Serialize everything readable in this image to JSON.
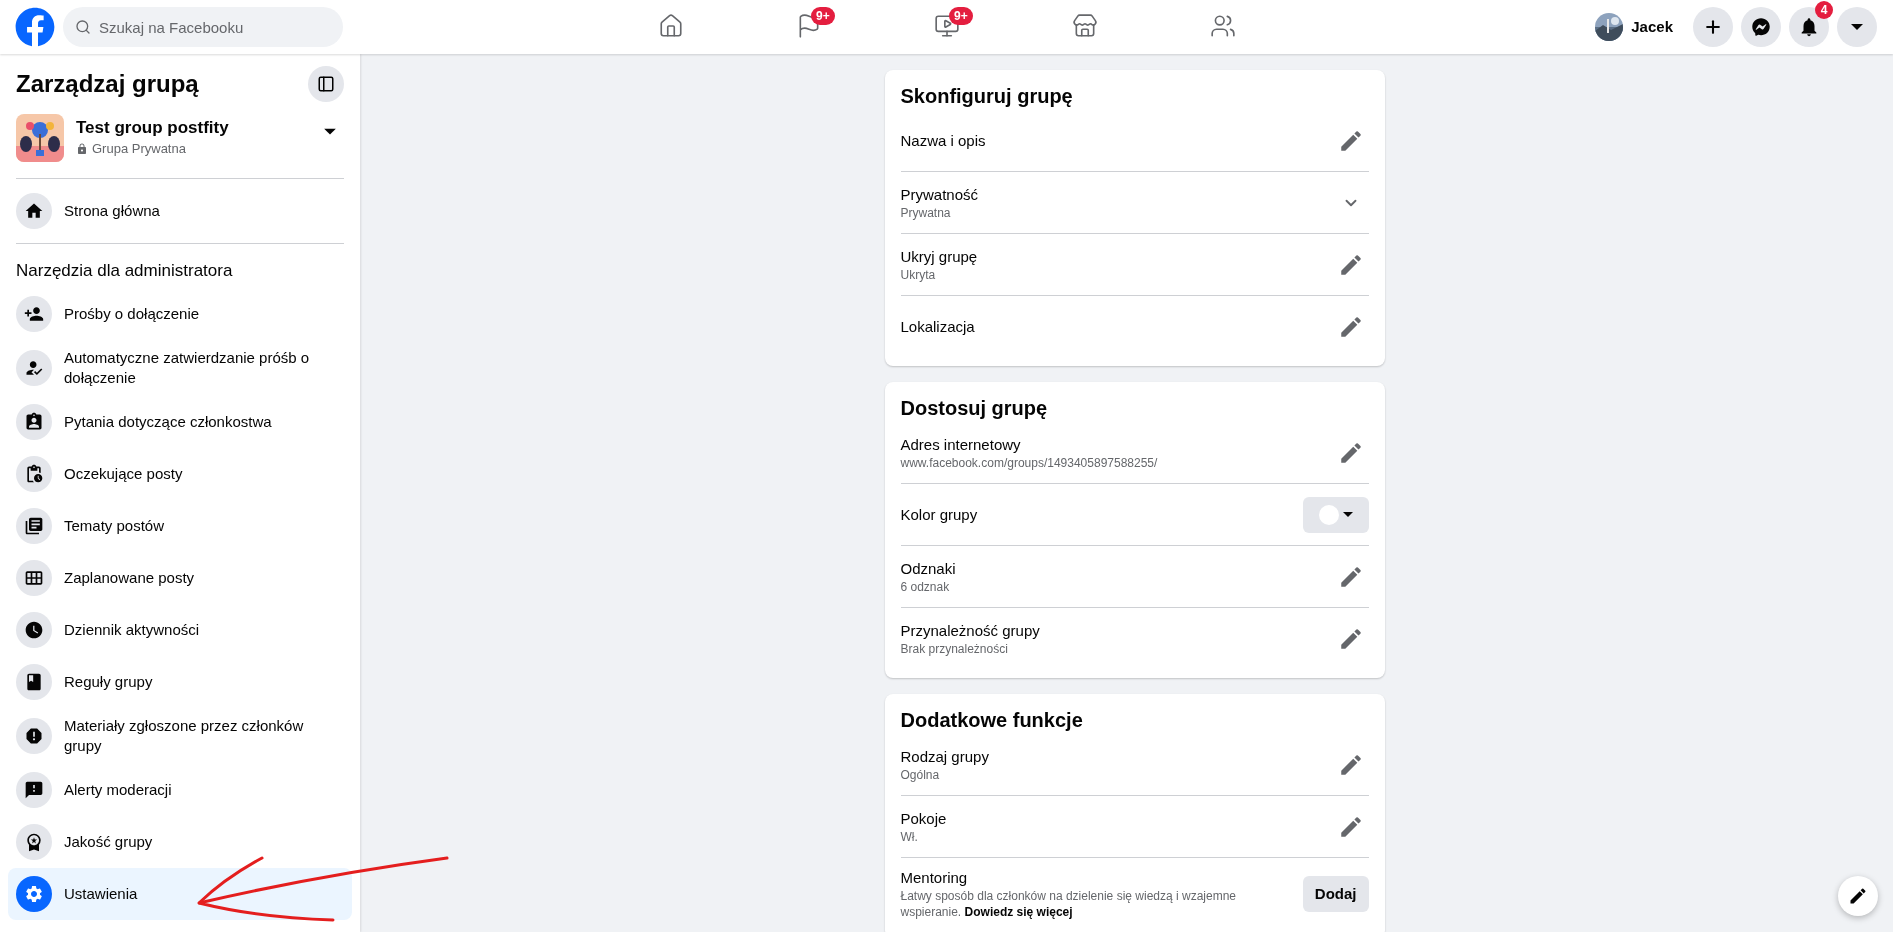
{
  "top_bar": {
    "search": {
      "placeholder": "Szukaj na Facebooku"
    },
    "nav_tabs": [
      {
        "kind": "home",
        "selected": false
      },
      {
        "kind": "flag",
        "selected": false,
        "badge": "9+"
      },
      {
        "kind": "video",
        "selected": false,
        "badge": "9+"
      },
      {
        "kind": "store",
        "selected": false
      },
      {
        "kind": "groups",
        "selected": false
      }
    ],
    "profile": {
      "name": "Jacek"
    },
    "actions": [
      {
        "kind": "plus"
      },
      {
        "kind": "messenger"
      },
      {
        "kind": "bell",
        "badge": "4"
      },
      {
        "kind": "caret"
      }
    ]
  },
  "sidebar": {
    "title": "Zarządzaj grupą",
    "group": {
      "name": "Test group postfity",
      "privacy": "Grupa Prywatna"
    },
    "home_item": {
      "kind": "home",
      "label": "Strona główna",
      "selected": false
    },
    "section_title": "Narzędzia dla administratora",
    "items": [
      {
        "kind": "requests",
        "label": "Prośby o dołączenie",
        "selected": false
      },
      {
        "kind": "auto",
        "label": "Automatyczne zatwierdzanie próśb o dołączenie",
        "selected": false
      },
      {
        "kind": "questions",
        "label": "Pytania dotyczące członkostwa",
        "selected": false
      },
      {
        "kind": "pending",
        "label": "Oczekujące posty",
        "selected": false
      },
      {
        "kind": "topics",
        "label": "Tematy postów",
        "selected": false
      },
      {
        "kind": "scheduled",
        "label": "Zaplanowane posty",
        "selected": false
      },
      {
        "kind": "log",
        "label": "Dziennik aktywności",
        "selected": false
      },
      {
        "kind": "rules",
        "label": "Reguły grupy",
        "selected": false
      },
      {
        "kind": "reported",
        "label": "Materiały zgłoszone przez członków grupy",
        "selected": false
      },
      {
        "kind": "alerts",
        "label": "Alerty moderacji",
        "selected": false
      },
      {
        "kind": "quality",
        "label": "Jakość grupy",
        "selected": false
      },
      {
        "kind": "settings",
        "label": "Ustawienia",
        "selected": true
      }
    ]
  },
  "cards": [
    {
      "title": "Skonfiguruj grupę",
      "rows": [
        {
          "kind": "edit",
          "label": "Nazwa i opis"
        },
        {
          "kind": "expand",
          "label": "Prywatność",
          "value": "Prywatna"
        },
        {
          "kind": "edit",
          "label": "Ukryj grupę",
          "value": "Ukryta"
        },
        {
          "kind": "edit",
          "label": "Lokalizacja"
        }
      ]
    },
    {
      "title": "Dostosuj grupę",
      "rows": [
        {
          "kind": "edit",
          "label": "Adres internetowy",
          "value": "www.facebook.com/groups/1493405897588255/"
        },
        {
          "kind": "color",
          "label": "Kolor grupy"
        },
        {
          "kind": "edit",
          "label": "Odznaki",
          "value": "6 odznak"
        },
        {
          "kind": "edit",
          "label": "Przynależność grupy",
          "value": "Brak przynależności"
        }
      ]
    },
    {
      "title": "Dodatkowe funkcje",
      "rows": [
        {
          "kind": "edit",
          "label": "Rodzaj grupy",
          "value": "Ogólna"
        },
        {
          "kind": "edit",
          "label": "Pokoje",
          "value": "Wł."
        },
        {
          "kind": "button",
          "label": "Mentoring",
          "value": "Łatwy sposób dla członków na dzielenie się wiedzą i wzajemne wspieranie.",
          "link": "Dowiedz się więcej",
          "button": "Dodaj"
        }
      ]
    }
  ]
}
